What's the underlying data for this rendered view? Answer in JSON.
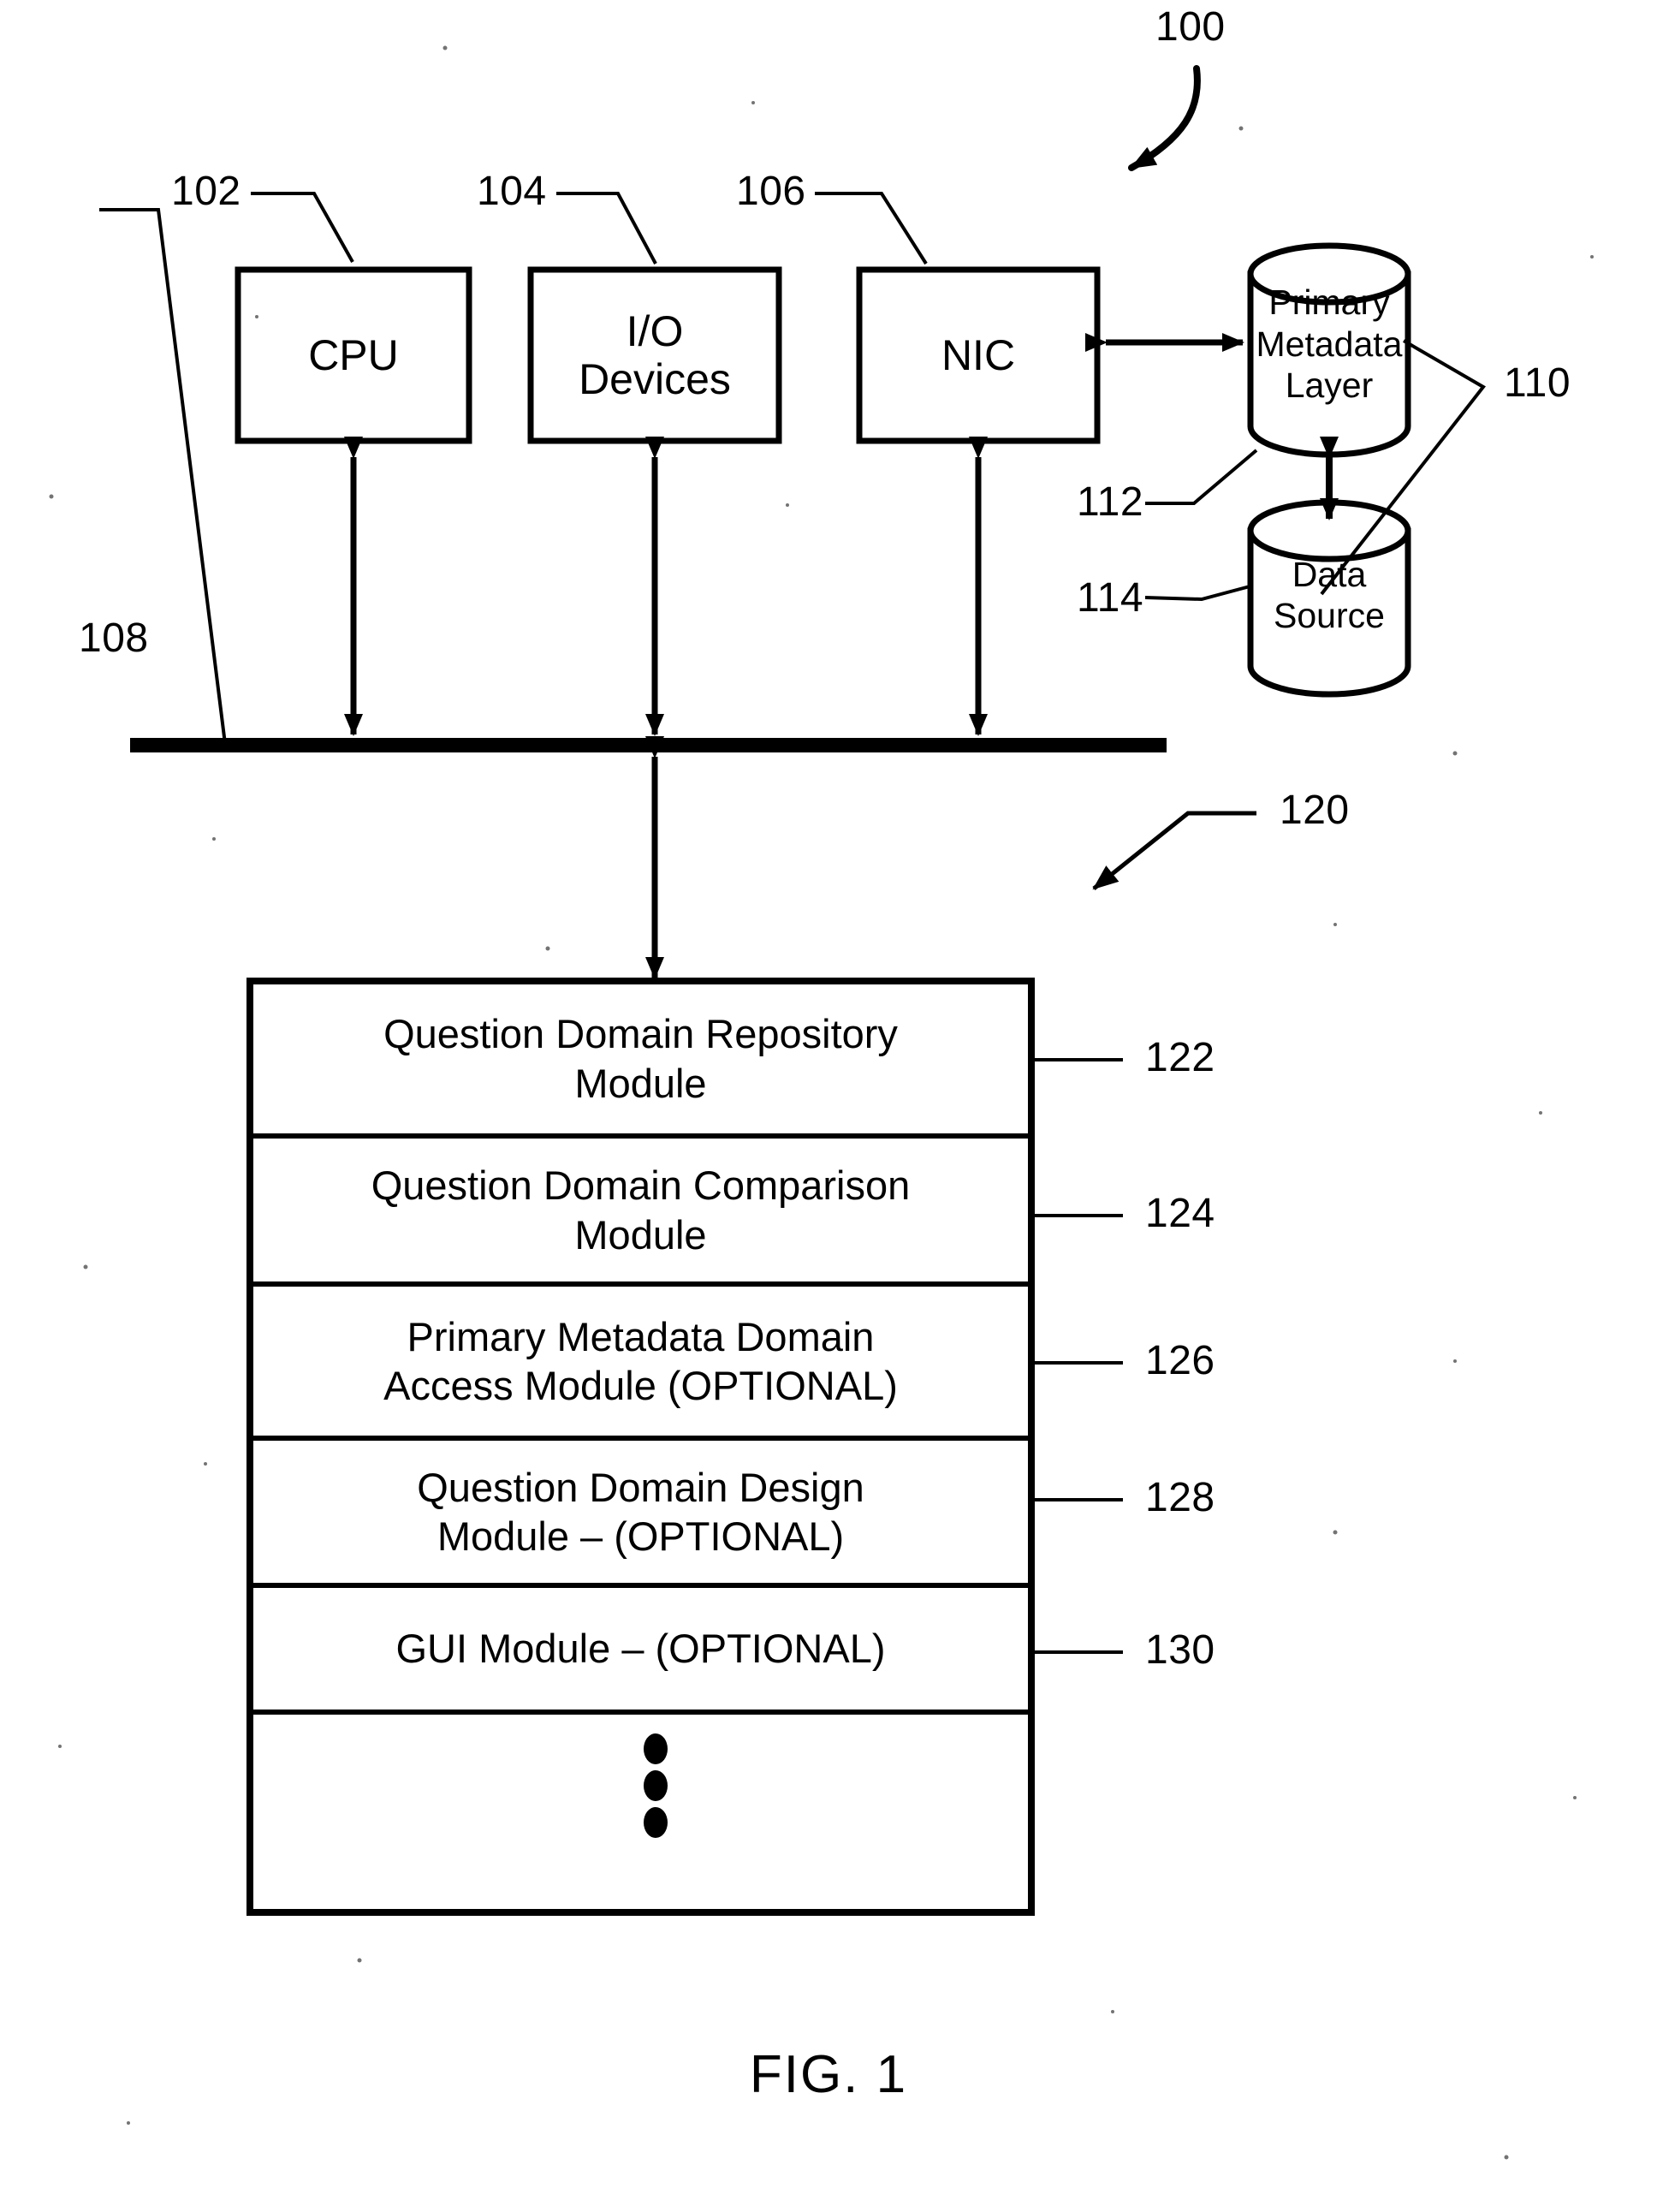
{
  "figure": {
    "caption": "FIG. 1",
    "system_ref": "100",
    "software_ref": "120"
  },
  "hardware": {
    "boxes": [
      {
        "label": "CPU",
        "ref": "102"
      },
      {
        "label": "I/O\nDevices",
        "ref": "104"
      },
      {
        "label": "NIC",
        "ref": "106"
      }
    ],
    "bus": {
      "ref": "108"
    }
  },
  "storage": {
    "group_ref": "110",
    "cylinders": [
      {
        "label": "Primary\nMetadata\nLayer",
        "ref": "112"
      },
      {
        "label": "Data\nSource",
        "ref": "114"
      }
    ]
  },
  "modules": {
    "rows": [
      {
        "label": "Question Domain Repository\nModule",
        "ref": "122"
      },
      {
        "label": "Question Domain Comparison\nModule",
        "ref": "124"
      },
      {
        "label": "Primary Metadata Domain\nAccess Module (OPTIONAL)",
        "ref": "126"
      },
      {
        "label": "Question Domain Design\nModule – (OPTIONAL)",
        "ref": "128"
      },
      {
        "label": "GUI Module – (OPTIONAL)",
        "ref": "130"
      },
      {
        "label": "",
        "ref": ""
      }
    ],
    "ellipsis_glyph": "vertical-ellipsis"
  },
  "colors": {
    "ink": "#000000",
    "paper": "#ffffff"
  }
}
